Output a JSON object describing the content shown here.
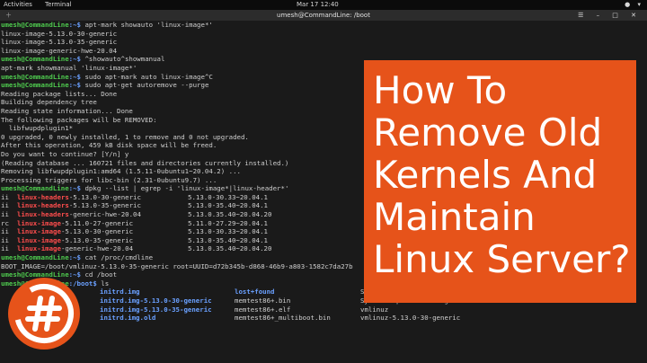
{
  "topbar": {
    "activities": "Activities",
    "app": "Terminal",
    "clock": "Mar 17  12:40",
    "tray": "● ▾"
  },
  "window": {
    "title": "umesh@CommandLine: /boot"
  },
  "terminal_lines": [
    {
      "prompt": "umesh@CommandLine",
      "path": ":~$",
      "cmd": " apt-mark showauto 'linux-image*'"
    },
    {
      "text": "linux-image-5.13.0-30-generic"
    },
    {
      "text": "linux-image-5.13.0-35-generic"
    },
    {
      "text": "linux-image-generic-hwe-20.04"
    },
    {
      "prompt": "umesh@CommandLine",
      "path": ":~$",
      "cmd": " ^showauto^showmanual"
    },
    {
      "text": "apt-mark showmanual 'linux-image*'"
    },
    {
      "prompt": "umesh@CommandLine",
      "path": ":~$",
      "cmd": " sudo apt-mark auto linux-image^C"
    },
    {
      "prompt": "umesh@CommandLine",
      "path": ":~$",
      "cmd": " sudo apt-get autoremove --purge"
    },
    {
      "text": "Reading package lists... Done"
    },
    {
      "text": "Building dependency tree"
    },
    {
      "text": "Reading state information... Done"
    },
    {
      "text": "The following packages will be REMOVED:"
    },
    {
      "text": "  libfwupdplugin1*"
    },
    {
      "text": "0 upgraded, 0 newly installed, 1 to remove and 0 not upgraded."
    },
    {
      "text": "After this operation, 459 kB disk space will be freed."
    },
    {
      "text": "Do you want to continue? [Y/n] y"
    },
    {
      "text": "(Reading database ... 160721 files and directories currently installed.)"
    },
    {
      "text": "Removing libfwupdplugin1:amd64 (1.5.11-0ubuntu1~20.04.2) ..."
    },
    {
      "text": "Processing triggers for libc-bin (2.31-0ubuntu9.7) ..."
    },
    {
      "prompt": "umesh@CommandLine",
      "path": ":~$",
      "cmd": " dpkg --list | egrep -i 'linux-image*|linux-header*'"
    }
  ],
  "packages": [
    {
      "st": "ii",
      "hl": "linux-headers",
      "rest": "-5.13.0-30-generic",
      "ver": "5.13.0-30.33~20.04.1"
    },
    {
      "st": "ii",
      "hl": "linux-headers",
      "rest": "-5.13.0-35-generic",
      "ver": "5.13.0-35.40~20.04.1"
    },
    {
      "st": "ii",
      "hl": "linux-headers",
      "rest": "-generic-hwe-20.04",
      "ver": "5.13.0.35.40~20.04.20"
    },
    {
      "st": "rc",
      "hl": "linux-image",
      "rest": "-5.11.0-27-generic",
      "ver": "5.11.0-27.29~20.04.1"
    },
    {
      "st": "ii",
      "hl": "linux-image",
      "rest": "-5.13.0-30-generic",
      "ver": "5.13.0-30.33~20.04.1"
    },
    {
      "st": "ii",
      "hl": "linux-image",
      "rest": "-5.13.0-35-generic",
      "ver": "5.13.0-35.40~20.04.1"
    },
    {
      "st": "ii",
      "hl": "linux-image",
      "rest": "-generic-hwe-20.04",
      "ver": "5.13.0.35.40~20.04.20"
    }
  ],
  "after_lines": [
    {
      "prompt": "umesh@CommandLine",
      "path": ":~$",
      "cmd": " cat /proc/cmdline"
    },
    {
      "text": "BOOT_IMAGE=/boot/vmlinuz-5.13.0-35-generic root=UUID=d72b345b-d868-46b9-a803-1582c7da27b"
    },
    {
      "prompt": "umesh@CommandLine",
      "path": ":~$",
      "cmd": " cd /boot"
    },
    {
      "prompt": "umesh@CommandLine",
      "path": ":/boot$",
      "cmd": " ls"
    }
  ],
  "ls_rows": [
    {
      "a": "",
      "b": "initrd.img",
      "c": "lost+found",
      "d": "System.map-5.13.0-30-generic"
    },
    {
      "a": "",
      "b": "initrd.img-5.13.0-30-generic",
      "c": "memtest86+.bin",
      "d": "System.map-5.13.0-35-generic"
    },
    {
      "a": "",
      "b": "initrd.img-5.13.0-35-generic",
      "c": "memtest86+.elf",
      "d": "vmlinuz"
    },
    {
      "a": "",
      "b": "initrd.img.old",
      "c": "memtest86+_multiboot.bin",
      "d": "vmlinuz-5.13.0-30-generic"
    }
  ],
  "overlay": {
    "lines": [
      "How To",
      "Remove Old",
      "Kernels And",
      "Maintain",
      "Linux Server?"
    ]
  },
  "colors": {
    "accent": "#e6531a",
    "prompt": "#4ec94e",
    "highlight": "#ff4d4d",
    "path": "#6aa0ff"
  },
  "icons": {
    "logo": "hash-circle-logo-icon"
  }
}
